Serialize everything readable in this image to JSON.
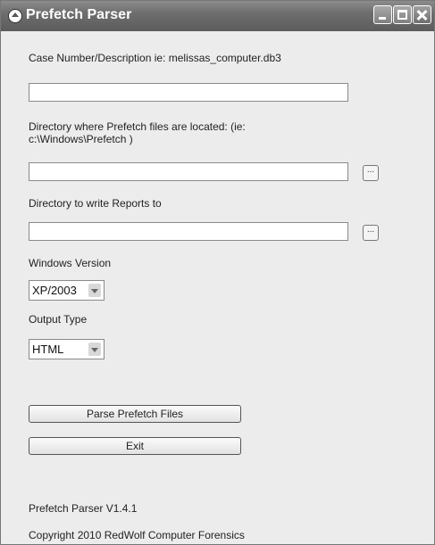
{
  "window": {
    "title": "Prefetch Parser"
  },
  "labels": {
    "case": "Case Number/Description ie: melissas_computer.db3",
    "prefetch_dir_line1": "Directory where Prefetch files are located: (ie:",
    "prefetch_dir_line2": "c:\\Windows\\Prefetch )",
    "reports_dir": "Directory to write Reports to",
    "windows_version": "Windows Version",
    "output_type": "Output Type"
  },
  "fields": {
    "case_value": "",
    "prefetch_dir_value": "",
    "reports_dir_value": ""
  },
  "browse_label": "...",
  "selects": {
    "windows_version": "XP/2003",
    "output_type": "HTML"
  },
  "buttons": {
    "parse": "Parse Prefetch Files",
    "exit": "Exit"
  },
  "footer": {
    "version": "Prefetch Parser V1.4.1",
    "copyright": "Copyright 2010 RedWolf Computer Forensics"
  },
  "icons": [
    "app-icon",
    "minimize-icon",
    "maximize-icon",
    "close-icon",
    "chevron-down-icon"
  ]
}
